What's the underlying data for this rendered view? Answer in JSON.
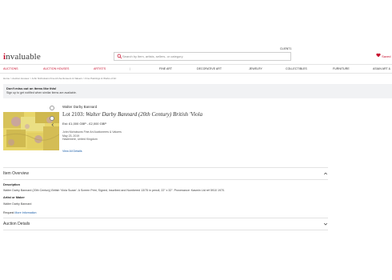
{
  "header": {
    "logo_i": "i",
    "logo_rest": "nvaluable",
    "search_placeholder": "Search by item, artists, sellers, or category",
    "client_no": "CLIENT1",
    "saved_label": "Saved"
  },
  "nav": {
    "items": [
      "AUCTIONS",
      "AUCTION HOUSES",
      "ARTISTS",
      "FINE ART",
      "DECORATIVE ART",
      "JEWELRY",
      "COLLECTIBLES",
      "FURNITURE",
      "ASIAN ART &"
    ],
    "separator": "|"
  },
  "breadcrumb": "Home > Auction Houses > John Nicholsons Fine Art Auctioneers & Valuers > Fine Paintings & Works of Art",
  "alert": {
    "title": "Don't miss out on items like this!",
    "subtitle": "Sign up to get notified when similar items are available."
  },
  "lot": {
    "artist": "Walter Darby Bannard",
    "lot_number": "Lot 2103: ",
    "title": "Walter Darby Bannard (20th Century) British 'Viola",
    "estimate": "Est: £1,000 GBP - £2,000 GBP",
    "house_name": "John Nicholsons Fine Art Auctioneers & Valuers",
    "date": "May 23, 2019",
    "location": "Haslemere, United Kingdom",
    "view_all": "View All Details"
  },
  "overview": {
    "heading": "Item Overview",
    "description_label": "Description",
    "description_text": "Walter Darby Bannard (20th Century) British 'Viola Suzan'. A Screen Print, Signed, Inscribed and Numbered 13/75 in pencil, 22\" x 32\". Provenance: Kasmin Ltd ref 5910 1970.",
    "artist_label": "Artist or Maker",
    "artist_value": "Walter Darby Bannard",
    "request_prefix": "Request ",
    "request_link": "More Information"
  },
  "auction_details": {
    "heading": "Auction Details"
  },
  "colors": {
    "brand_red": "#c8102e",
    "link_blue": "#1a5ea8"
  }
}
